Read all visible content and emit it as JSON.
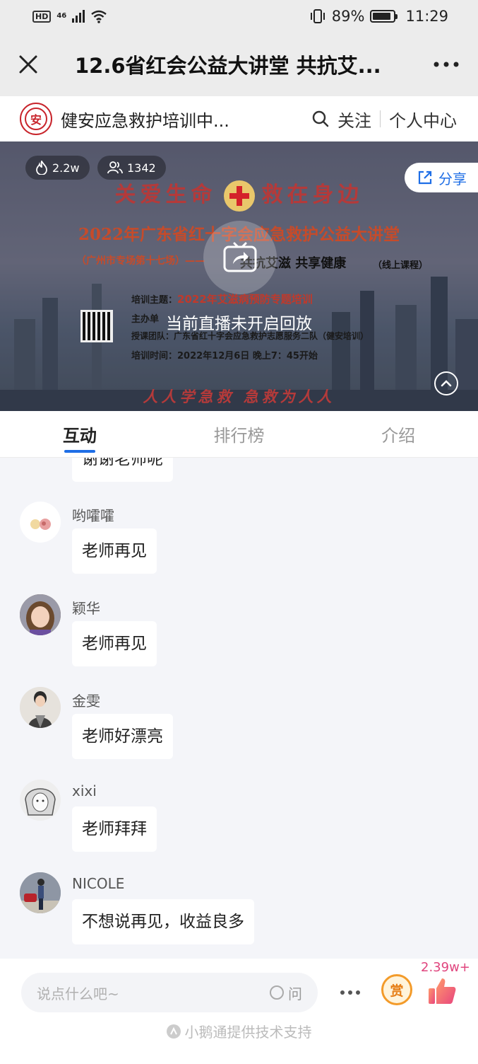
{
  "status_bar": {
    "hd": "HD",
    "network": "46",
    "battery": "89%",
    "time": "11:29"
  },
  "header": {
    "title": "12.6省红会公益大讲堂 共抗艾..."
  },
  "channel": {
    "name": "健安应急救护培训中...",
    "follow": "关注",
    "profile": "个人中心"
  },
  "video": {
    "heat": "2.2w",
    "viewers": "1342",
    "share_label": "分享",
    "no_replay_text": "当前直播未开启回放",
    "poster": {
      "slogan_left": "关爱生命",
      "slogan_right": "救在身边",
      "title": "2022年广东省红十字会应急救护公益大讲堂",
      "subtitle_left": "（广州市专场第十七场）——",
      "subtitle_mid": "共抗艾滋 共享健康",
      "subtitle_right": "（线上课程）",
      "topic_label": "培训主题：",
      "topic": "2022年艾滋病预防专题培训",
      "host_label": "主办单",
      "team": "授课团队：广东省红十字会应急救护志愿服务二队（健安培训）",
      "time": "培训时间：2022年12月6日 晚上7：45开始",
      "bottom_slogan": "人人学急救 急救为人人"
    }
  },
  "tabs": [
    {
      "label": "互动"
    },
    {
      "label": "排行榜"
    },
    {
      "label": "介绍"
    }
  ],
  "chat": {
    "partial_message": "谢谢老师呢",
    "messages": [
      {
        "user": "哟嚯嚯",
        "text": "老师再见"
      },
      {
        "user": "颖华",
        "text": "老师再见"
      },
      {
        "user": "金雯",
        "text": "老师好漂亮"
      },
      {
        "user": "xixi",
        "text": "老师拜拜"
      },
      {
        "user": "NICOLE",
        "text": "不想说再见，收益良多"
      }
    ]
  },
  "bottom_bar": {
    "input_placeholder": "说点什么吧~",
    "ask_label": "问",
    "reward_label": "赏",
    "like_count": "2.39w+",
    "credit": "小鹅通提供技术支持"
  },
  "colors": {
    "accent": "#1e6ee6",
    "brand_red": "#c8242b",
    "like_pink": "#e0457e",
    "reward_orange": "#f39b2a"
  }
}
